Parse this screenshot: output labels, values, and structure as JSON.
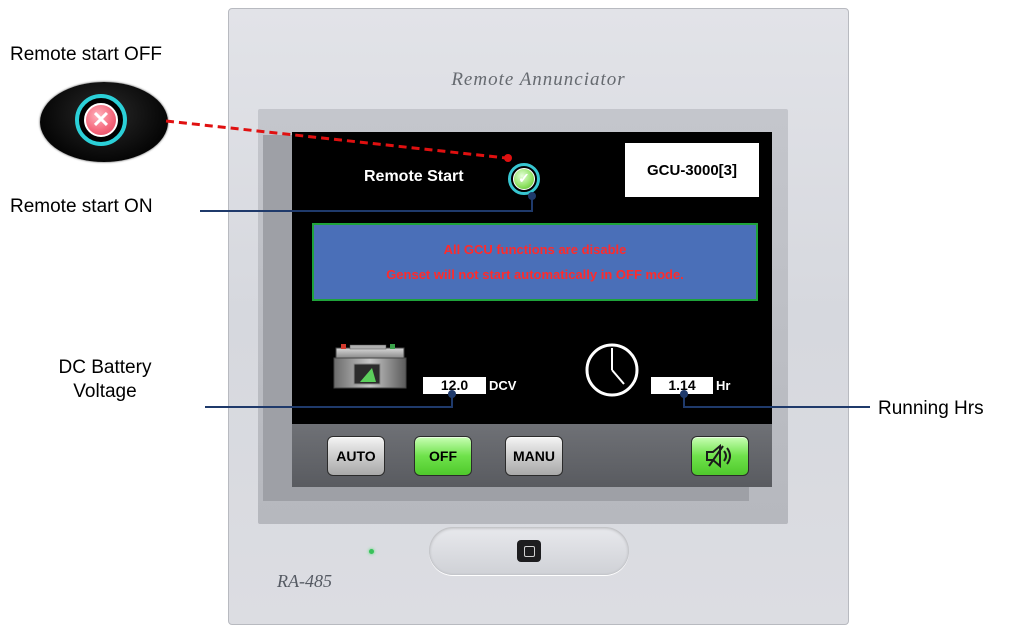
{
  "callouts": {
    "remote_off": "Remote start OFF",
    "remote_on": "Remote start ON",
    "dc_battery_line1": "DC Battery",
    "dc_battery_line2": "Voltage",
    "running_hrs": "Running Hrs"
  },
  "device": {
    "title": "Remote Annunciator",
    "model": "RA-485"
  },
  "screen": {
    "remote_start_label": "Remote Start",
    "unit_id": "GCU-3000[3]",
    "alert_line1": "All GCU functions are disable",
    "alert_line2": "Genset will not start automatically in OFF mode.",
    "battery_voltage": "12.0",
    "battery_unit": "DCV",
    "running_hours": "1.14",
    "running_unit": "Hr"
  },
  "buttons": {
    "auto": "AUTO",
    "off": "OFF",
    "manu": "MANU"
  },
  "colors": {
    "alert_bg": "#4a6fb8",
    "alert_text": "#ff2b2b",
    "active_button": "#6fe24b",
    "callout_line": "#1f3a6b",
    "remote_off_line": "#e01010"
  },
  "icons": {
    "remote_on": "check-circle-icon",
    "remote_off": "x-circle-icon",
    "battery": "battery-icon",
    "clock": "clock-icon",
    "mute": "speaker-mute-icon",
    "hw_button": "square-button-icon"
  }
}
